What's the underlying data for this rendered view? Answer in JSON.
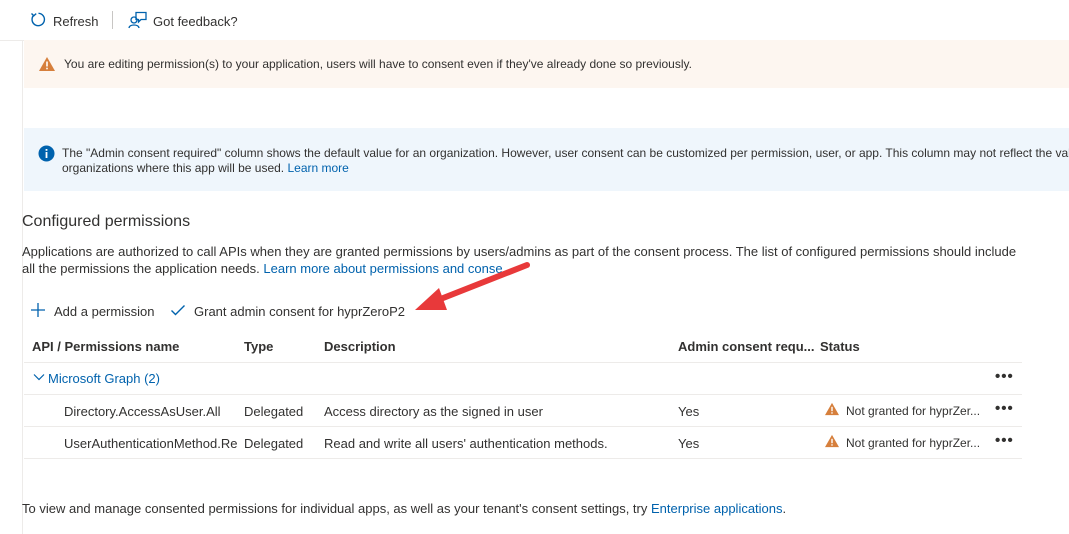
{
  "toolbar": {
    "refresh_label": "Refresh",
    "feedback_label": "Got feedback?"
  },
  "warning_banner": {
    "text": "You are editing permission(s) to your application, users will have to consent even if they've already done so previously.",
    "icon": "warning-icon",
    "color": "#d67f3c"
  },
  "info_banner": {
    "line1": "The \"Admin consent required\" column shows the default value for an organization. However, user consent can be customized per permission, user, or app. This column may not reflect the valu",
    "line2": "organizations where this app will be used.",
    "link": "Learn more",
    "icon": "info-icon",
    "color": "#0062ad"
  },
  "section": {
    "title": "Configured permissions",
    "description_1": "Applications are authorized to call APIs when they are granted permissions by users/admins as part of the consent process. The list of configured permissions should include",
    "description_2": "all the permissions the application needs.",
    "description_link": "Learn more about permissions and conse"
  },
  "commands": {
    "add_permission": "Add a permission",
    "grant_consent": "Grant admin consent for hyprZeroP2"
  },
  "table": {
    "headers": [
      "API / Permissions name",
      "Type",
      "Description",
      "Admin consent requ...",
      "Status"
    ],
    "group": {
      "label": "Microsoft Graph (2)"
    },
    "rows": [
      {
        "name": "Directory.AccessAsUser.All",
        "type": "Delegated",
        "description": "Access directory as the signed in user",
        "admin_consent": "Yes",
        "status": "Not granted for hyprZer..."
      },
      {
        "name": "UserAuthenticationMethod.Reac",
        "type": "Delegated",
        "description": "Read and write all users' authentication methods.",
        "admin_consent": "Yes",
        "status": "Not granted for hyprZer..."
      }
    ],
    "more_label": "•••"
  },
  "footer": {
    "text": "To view and manage consented permissions for individual apps, as well as your tenant's consent settings, try",
    "link": "Enterprise applications",
    "suffix": "."
  },
  "colors": {
    "accent": "#0062ad",
    "warning": "#d67f3c",
    "annotation_arrow": "#e8393a"
  }
}
